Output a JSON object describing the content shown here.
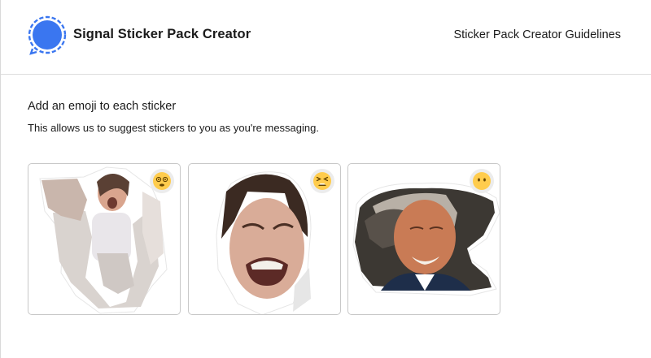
{
  "header": {
    "logo_icon": "signal-logo-icon",
    "title": "Signal Sticker Pack Creator",
    "guidelines_link": "Sticker Pack Creator Guidelines"
  },
  "step": {
    "title": "Add an emoji to each sticker",
    "description": "This allows us to suggest stickers to you as you're messaging."
  },
  "stickers": [
    {
      "subject": "woman-holding-shirt",
      "emoji": "dizzy-face-emoji"
    },
    {
      "subject": "woman-grimacing",
      "emoji": "tired-face-emoji"
    },
    {
      "subject": "smiling-man",
      "emoji": "face-without-mouth-emoji"
    }
  ],
  "colors": {
    "signal_blue": "#3a76f0",
    "emoji_yellow": "#ffcc4d",
    "card_border": "#c8c8c8"
  }
}
